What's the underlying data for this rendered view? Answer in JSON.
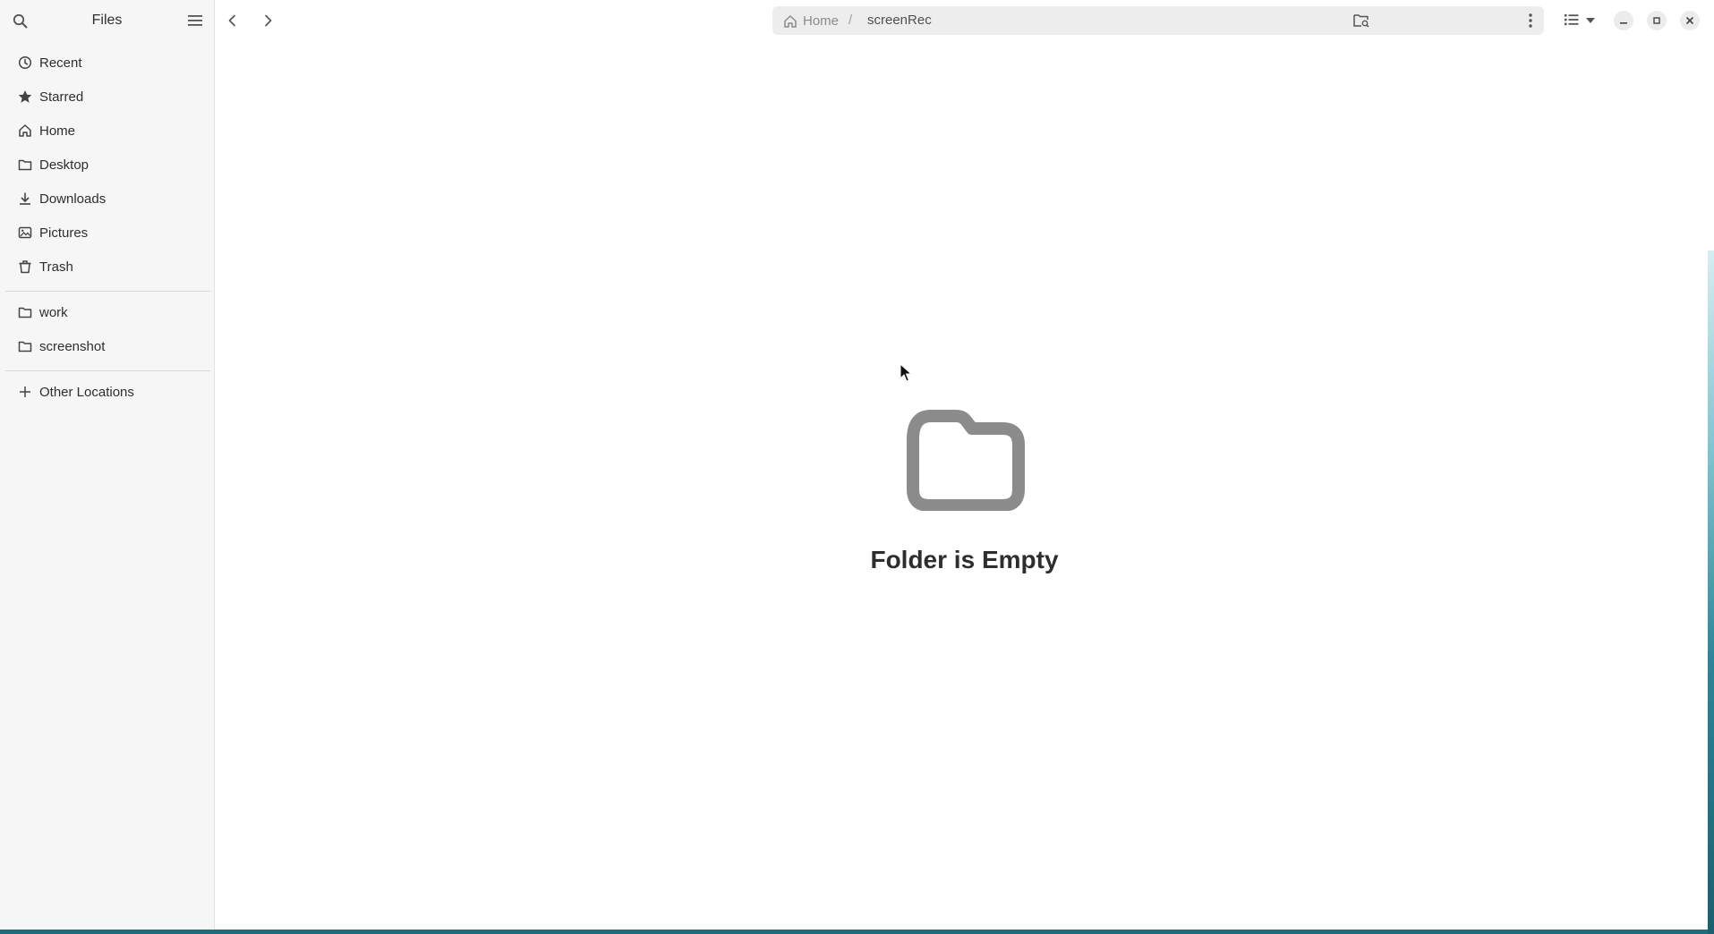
{
  "app": {
    "title": "Files"
  },
  "sidebar": {
    "places": [
      {
        "label": "Recent",
        "icon": "clock-icon"
      },
      {
        "label": "Starred",
        "icon": "star-icon"
      },
      {
        "label": "Home",
        "icon": "home-icon"
      },
      {
        "label": "Desktop",
        "icon": "folder-icon"
      },
      {
        "label": "Downloads",
        "icon": "download-icon"
      },
      {
        "label": "Pictures",
        "icon": "image-icon"
      },
      {
        "label": "Trash",
        "icon": "trash-icon"
      }
    ],
    "bookmarks": [
      {
        "label": "work",
        "icon": "folder-icon"
      },
      {
        "label": "screenshot",
        "icon": "folder-icon"
      }
    ],
    "other_locations": {
      "label": "Other Locations",
      "icon": "plus-icon"
    }
  },
  "pathbar": {
    "home_label": "Home",
    "separator": "/",
    "current": "screenRec"
  },
  "content": {
    "empty_message": "Folder is Empty"
  },
  "colors": {
    "sidebar_bg": "#f6f6f6",
    "pathbar_bg": "#ededed",
    "empty_icon": "#8b8b8b",
    "text": "#2e2e2e"
  }
}
